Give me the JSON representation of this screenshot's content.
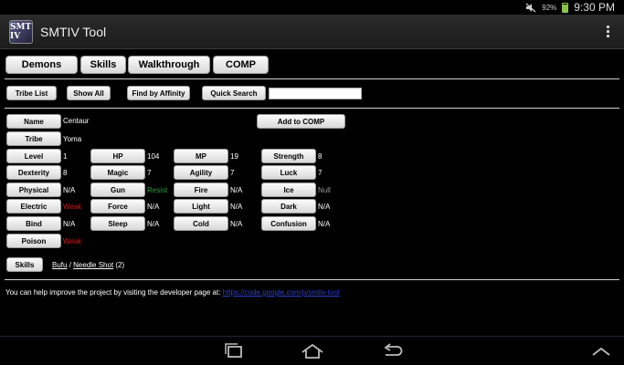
{
  "status": {
    "battery_pct": "92%",
    "time": "9:30 PM"
  },
  "app": {
    "icon_text": "SMT IV",
    "title": "SMTIV Tool"
  },
  "tabs": [
    {
      "label": "Demons"
    },
    {
      "label": "Skills"
    },
    {
      "label": "Walkthrough"
    },
    {
      "label": "COMP"
    }
  ],
  "toolbar": {
    "tribe_list": "Tribe List",
    "show_all": "Show All",
    "find_by_affinity": "Find by Affinity",
    "quick_search": "Quick Search",
    "search_value": ""
  },
  "demon": {
    "name_label": "Name",
    "name": "Centaur",
    "add_to_comp": "Add to COMP",
    "tribe_label": "Tribe",
    "tribe": "Yoma",
    "level_label": "Level",
    "level": "1",
    "hp_label": "HP",
    "hp": "104",
    "mp_label": "MP",
    "mp": "19",
    "strength_label": "Strength",
    "strength": "8",
    "dexterity_label": "Dexterity",
    "dexterity": "8",
    "magic_label": "Magic",
    "magic": "7",
    "agility_label": "Agility",
    "agility": "7",
    "luck_label": "Luck",
    "luck": "7"
  },
  "affinities": {
    "physical_label": "Physical",
    "physical": "N/A",
    "gun_label": "Gun",
    "gun": "Resist",
    "fire_label": "Fire",
    "fire": "N/A",
    "ice_label": "Ice",
    "ice": "Null",
    "electric_label": "Electric",
    "electric": "Weak",
    "force_label": "Force",
    "force": "N/A",
    "light_label": "Light",
    "light": "N/A",
    "dark_label": "Dark",
    "dark": "N/A",
    "bind_label": "Bind",
    "bind": "N/A",
    "sleep_label": "Sleep",
    "sleep": "N/A",
    "cold_label": "Cold",
    "cold": "N/A",
    "confusion_label": "Confusion",
    "confusion": "N/A",
    "poison_label": "Poison",
    "poison": "Weak"
  },
  "skills": {
    "label": "Skills",
    "skill1": "Bufu",
    "separator": " / ",
    "skill2": "Needle Shot",
    "extra": " (2)"
  },
  "footer": {
    "text": "You can help improve the project by visiting the developer page at: ",
    "url": "https://code.google.com/p/smtiv-tool"
  },
  "colors": {
    "resist": "#2e9e3c",
    "null": "#9a9a9a",
    "weak": "#d11a1a",
    "link": "#2d3fd0"
  },
  "icons": {
    "status": [
      "mute-icon",
      "battery-icon"
    ],
    "nav": [
      "recent-apps-icon",
      "home-icon",
      "back-icon",
      "chevron-up-icon"
    ],
    "menu": "overflow-menu-icon"
  }
}
